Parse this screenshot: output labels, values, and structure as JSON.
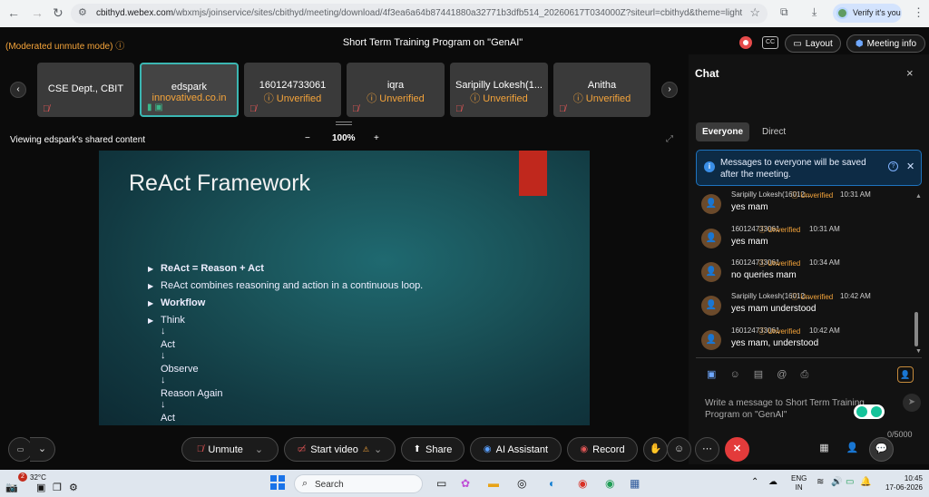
{
  "browser": {
    "back": "←",
    "forward": "→",
    "reload": "↻",
    "url_host": "cbithyd.webex.com",
    "url_path": "/wbxmjs/joinservice/sites/cbithyd/meeting/download/4f3ea6a64b87441880a32771b3dfb514_20260617T034000Z?siteurl=cbithyd&theme=light",
    "verify_label": "Verify it's you"
  },
  "meeting": {
    "moderated_label": "(Moderated unmute mode)",
    "title": "Short Term Training Program on \"GenAI\"",
    "layout_label": "Layout",
    "meeting_info_label": "Meeting info",
    "cc_label": "CC"
  },
  "participants": [
    {
      "name": "CSE Dept., CBIT",
      "status": ""
    },
    {
      "name": "edspark",
      "status": "innovatived.co.in"
    },
    {
      "name": "160124733061",
      "status": "Unverified"
    },
    {
      "name": "iqra",
      "status": "Unverified"
    },
    {
      "name": "Saripilly Lokesh(1...",
      "status": "Unverified"
    },
    {
      "name": "Anitha",
      "status": "Unverified"
    }
  ],
  "share": {
    "viewing_label": "Viewing edspark's shared content",
    "zoom": "100%",
    "zoom_out": "−",
    "zoom_in": "+"
  },
  "slide": {
    "title": "ReAct Framework",
    "bullets": [
      {
        "text": "ReAct = Reason + Act",
        "bold": true
      },
      {
        "text": "ReAct combines reasoning and action in a continuous loop.",
        "bold": false
      },
      {
        "text": "Workflow",
        "bold": true
      },
      {
        "text": "Think",
        "bold": false
      }
    ],
    "flow": [
      "↓",
      "Act",
      "↓",
      "Observe",
      "↓",
      "Reason Again",
      "↓",
      "Act"
    ]
  },
  "chat": {
    "title": "Chat",
    "close": "×",
    "tabs": [
      "Everyone",
      "Direct"
    ],
    "notice": "Messages to everyone will be saved after the meeting.",
    "messages": [
      {
        "name": "Saripilly Lokesh(16012...",
        "status": "Unverified",
        "time": "10:31 AM",
        "text": "yes mam"
      },
      {
        "name": "160124733061",
        "status": "Unverified",
        "time": "10:31 AM",
        "text": "yes mam"
      },
      {
        "name": "160124733061",
        "status": "Unverified",
        "time": "10:34 AM",
        "text": "no queries mam"
      },
      {
        "name": "Saripilly Lokesh(16012...",
        "status": "Unverified",
        "time": "10:42 AM",
        "text": "yes mam understood"
      },
      {
        "name": "160124733061",
        "status": "Unverified",
        "time": "10:42 AM",
        "text": "yes mam, understood"
      }
    ],
    "compose_placeholder": "Write a message to Short Term Training Program on \"GenAI\"",
    "counter": "0/5000"
  },
  "controls": {
    "unmute": "Unmute",
    "start_video": "Start video",
    "share": "Share",
    "ai_assistant": "AI Assistant",
    "record": "Record"
  },
  "taskbar": {
    "temp": "32°C",
    "badge": "2",
    "search": "Search",
    "lang1": "ENG",
    "lang2": "IN",
    "time": "10:45",
    "date": "17-06-2026"
  },
  "colors": {
    "accent_orange": "#f5a43a",
    "leave_red": "#e33b3b",
    "active_tile": "#3bb6b2",
    "slide_bar": "#c0281d"
  }
}
